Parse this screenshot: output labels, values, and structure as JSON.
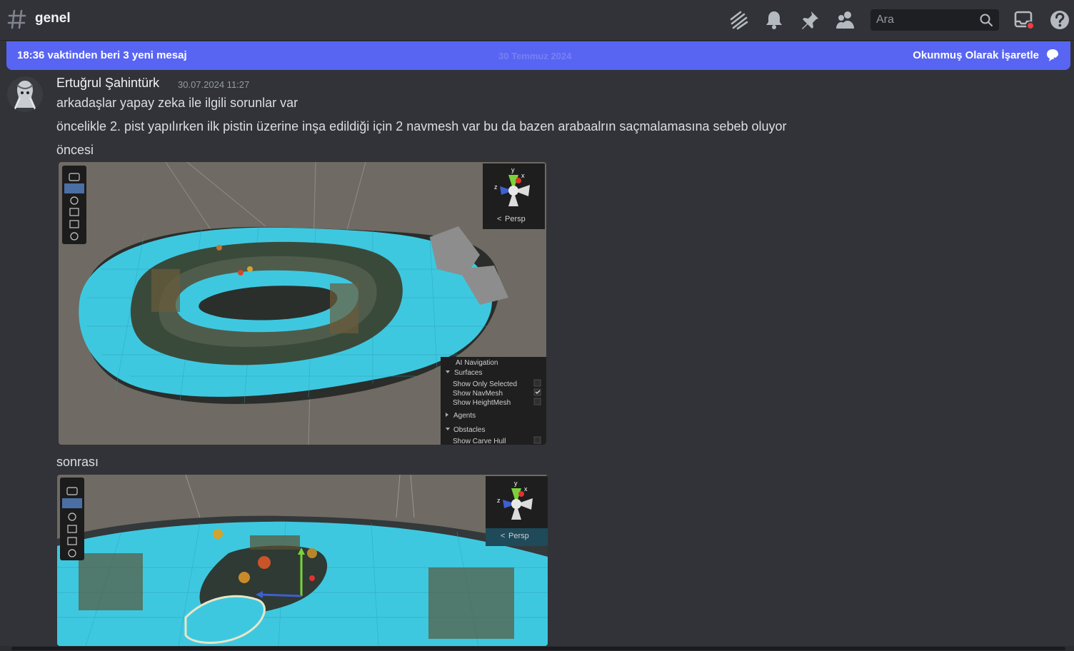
{
  "header": {
    "channel_name": "genel",
    "icons": [
      "threads-icon",
      "bell-icon",
      "pin-icon",
      "members-icon",
      "inbox-icon",
      "help-icon"
    ],
    "search_placeholder": "Ara"
  },
  "new_messages_bar": {
    "text": "18:36 vaktinden beri 3 yeni mesaj",
    "date_divider": "30 Temmuz 2024",
    "mark_read_label": "Okunmuş Olarak İşaretle"
  },
  "message": {
    "author": "Ertuğrul Şahintürk",
    "timestamp": "30.07.2024 11:27",
    "lines": [
      "arkadaşlar yapay zeka ile ilgili sorunlar var",
      "öncelikle 2. pist yapılırken ilk pistin üzerine inşa edildiği için 2 navmesh var bu da bazen arabaalrın saçmalamasına sebeb oluyor",
      "öncesi",
      "sonrası"
    ]
  },
  "attachments": {
    "scene_view": {
      "persp_label": "Persp",
      "axis_y": "y",
      "axis_x": "x",
      "axis_z": "z"
    },
    "ai_navigation_panel": {
      "title": "AI Navigation",
      "surfaces_label": "Surfaces",
      "show_only_selected": "Show Only Selected",
      "show_navmesh": "Show NavMesh",
      "show_heightmesh": "Show HeightMesh",
      "agents_label": "Agents",
      "obstacles_label": "Obstacles",
      "show_carve_hull": "Show Carve Hull"
    }
  },
  "colors": {
    "background": "#313338",
    "accent": "#5865f2",
    "navmesh": "#3ec8e0"
  }
}
